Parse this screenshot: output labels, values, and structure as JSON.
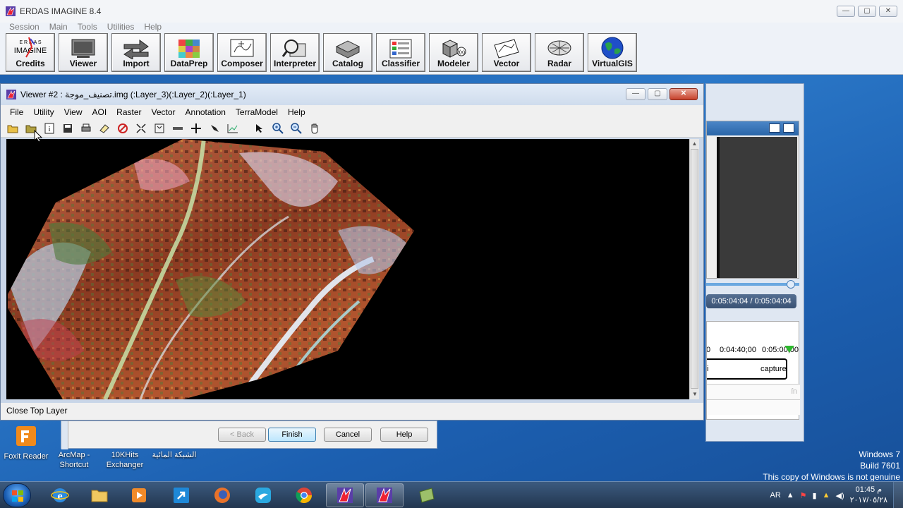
{
  "erdas": {
    "title": "ERDAS IMAGINE 8.4",
    "menu": [
      "Session",
      "Main",
      "Tools",
      "Utilities",
      "Help"
    ],
    "buttons": [
      {
        "label": "Credits",
        "icon": "erdas-logo-icon"
      },
      {
        "label": "Viewer",
        "icon": "monitor-icon"
      },
      {
        "label": "Import",
        "icon": "import-arrows-icon"
      },
      {
        "label": "DataPrep",
        "icon": "grid-icon"
      },
      {
        "label": "Composer",
        "icon": "map-composer-icon"
      },
      {
        "label": "Interpreter",
        "icon": "magnifier-icon"
      },
      {
        "label": "Catalog",
        "icon": "catalog-tray-icon"
      },
      {
        "label": "Classifier",
        "icon": "classifier-icon"
      },
      {
        "label": "Modeler",
        "icon": "modeler-icon"
      },
      {
        "label": "Vector",
        "icon": "vector-icon"
      },
      {
        "label": "Radar",
        "icon": "radar-icon"
      },
      {
        "label": "VirtualGIS",
        "icon": "globe-icon"
      }
    ],
    "logo_text": {
      "line1": "E R D A S",
      "line2": "IMAGINE"
    }
  },
  "viewer": {
    "title": "Viewer #2 : تصنيف_موجة.img (:Layer_3)(:Layer_2)(:Layer_1)",
    "menu": [
      "File",
      "Utility",
      "View",
      "AOI",
      "Raster",
      "Vector",
      "Annotation",
      "TerraModel",
      "Help"
    ],
    "status": "Close Top Layer"
  },
  "media_panel": {
    "time": "0:05:04:04 / 0:05:04:04",
    "ruler": [
      "0",
      "0:04:40;00",
      "0:05:00;00"
    ],
    "clip_left": "i",
    "clip_label": "capture",
    "track2_right": "ſn"
  },
  "wizard": {
    "back": "< Back",
    "finish": "Finish",
    "cancel": "Cancel",
    "help": "Help"
  },
  "desktop": {
    "icons": [
      {
        "label": "Foxit Reader"
      },
      {
        "label": "ArcMap - Shortcut"
      },
      {
        "label": "10KHits Exchanger"
      },
      {
        "label": "الشبكة المائية"
      }
    ],
    "watermark": [
      "Windows 7",
      "Build 7601",
      "This copy of Windows is not genuine"
    ]
  },
  "taskbar": {
    "lang": "AR",
    "time": "01:45 م",
    "date": "٢٠١٧/٠٥/٢٨"
  }
}
